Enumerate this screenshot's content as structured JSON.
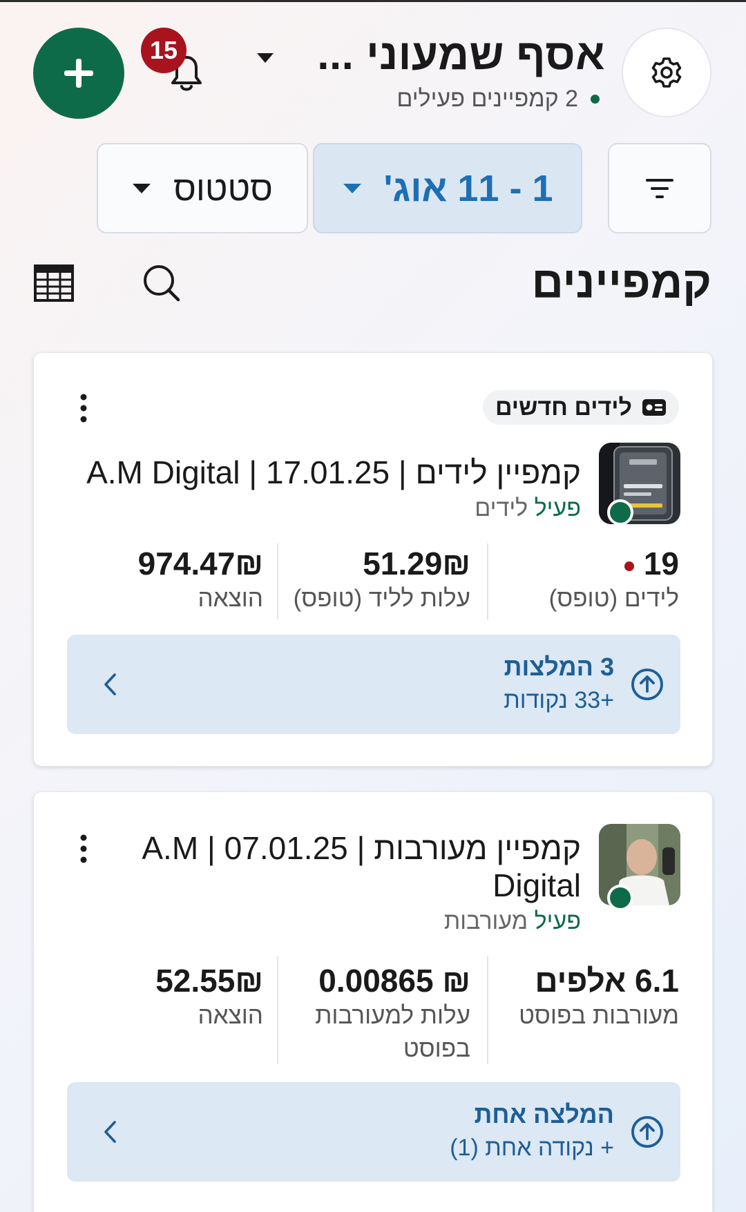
{
  "header": {
    "account_name": "אסף שמעוני ...",
    "active_campaigns": "2 קמפיינים פעילים",
    "notifications_count": "15"
  },
  "filters": {
    "date_range": "1 - 11 אוג'",
    "status": "סטטוס"
  },
  "page": {
    "title": "קמפיינים"
  },
  "campaigns": [
    {
      "tag": "לידים חדשים",
      "title": "קמפיין לידים | 17.01.25 | A.M Digital",
      "status_active": "פעיל",
      "status_type": "לידים",
      "metrics": [
        {
          "value": "19",
          "label": "לידים (טופס)"
        },
        {
          "value": "51.29₪",
          "label": "עלות לליד (טופס)"
        },
        {
          "value": "974.47₪",
          "label": "הוצאה"
        }
      ],
      "recommendation": {
        "title": "3 המלצות",
        "subtitle": "+33 נקודות"
      }
    },
    {
      "title": "קמפיין מעורבות | 07.01.25 | A.M Digital",
      "status_active": "פעיל",
      "status_type": "מעורבות",
      "metrics": [
        {
          "value": "6.1 אלפים",
          "label": "מעורבות בפוסט"
        },
        {
          "value": "₪ 0.00865",
          "label": "עלות למעורבות בפוסט"
        },
        {
          "value": "52.55₪",
          "label": "הוצאה"
        }
      ],
      "recommendation": {
        "title": "המלצה אחת",
        "subtitle": "+ נקודה אחת (1)"
      }
    }
  ],
  "colors": {
    "brand_green": "#0e6b4a",
    "accent_blue": "#1d6fb5",
    "badge_red": "#a8131e",
    "reco_bg": "#dce8f4"
  },
  "icons": [
    "plus-icon",
    "bell-icon",
    "chevron-down-icon",
    "gear-icon",
    "filter-lines-icon",
    "search-icon",
    "table-icon",
    "kebab-menu-icon",
    "lead-card-icon",
    "arrow-up-circle-icon",
    "chevron-left-icon"
  ]
}
